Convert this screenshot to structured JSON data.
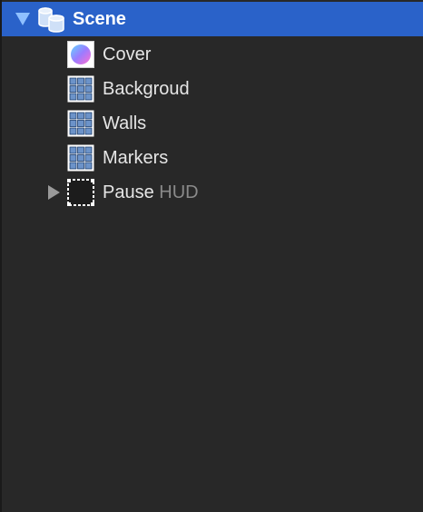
{
  "outline": {
    "root": {
      "label": "Scene",
      "icon": "scene-stack-icon",
      "expanded": true,
      "selected": true,
      "accent": "#2a62c9"
    },
    "items": [
      {
        "label": "Cover",
        "icon": "sprite-sphere-icon",
        "suffix": ""
      },
      {
        "label": "Backgroud",
        "icon": "tilemap-grid-icon",
        "suffix": ""
      },
      {
        "label": "Walls",
        "icon": "tilemap-grid-icon",
        "suffix": ""
      },
      {
        "label": "Markers",
        "icon": "tilemap-grid-icon",
        "suffix": ""
      },
      {
        "label": "Pause",
        "icon": "node-frame-icon",
        "suffix": "HUD",
        "expandable": true,
        "expanded": false
      }
    ]
  }
}
